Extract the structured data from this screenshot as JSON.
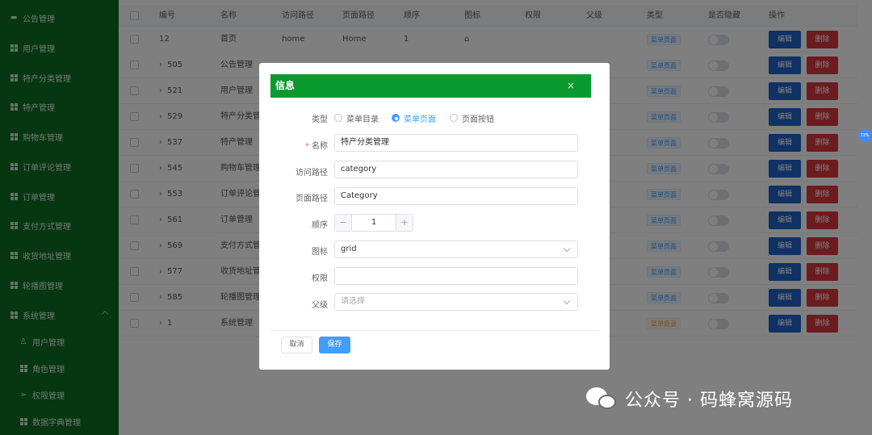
{
  "sidebar": {
    "items": [
      {
        "label": "公告管理",
        "icon": "message-icon"
      },
      {
        "label": "用户管理",
        "icon": "grid-icon"
      },
      {
        "label": "特产分类管理",
        "icon": "grid-icon"
      },
      {
        "label": "特产管理",
        "icon": "grid-icon"
      },
      {
        "label": "购物车管理",
        "icon": "grid-icon"
      },
      {
        "label": "订单评论管理",
        "icon": "grid-icon"
      },
      {
        "label": "订单管理",
        "icon": "grid-icon"
      },
      {
        "label": "支付方式管理",
        "icon": "grid-icon"
      },
      {
        "label": "收货地址管理",
        "icon": "grid-icon"
      },
      {
        "label": "轮播图管理",
        "icon": "grid-icon"
      },
      {
        "label": "系统管理",
        "icon": "apps-icon"
      }
    ],
    "sub_items": [
      {
        "label": "用户管理",
        "icon": "user-icon"
      },
      {
        "label": "角色管理",
        "icon": "grid-icon"
      },
      {
        "label": "权限管理",
        "icon": "send-icon"
      },
      {
        "label": "数据字典管理",
        "icon": "grid-icon"
      }
    ]
  },
  "table": {
    "columns": [
      "编号",
      "名称",
      "访问路径",
      "页面路径",
      "顺序",
      "图标",
      "权限",
      "父级",
      "类型",
      "是否隐藏",
      "操作"
    ],
    "rows": [
      {
        "id": "12",
        "name": "首页",
        "path": "home",
        "page": "Home",
        "order": "1",
        "icon": "⌂",
        "type": "菜单页面",
        "type_color": "blue",
        "expand": false
      },
      {
        "id": "505",
        "name": "公告管理",
        "path": "",
        "page": "",
        "order": "",
        "icon": "▪",
        "type": "菜单页面",
        "type_color": "blue",
        "expand": true
      },
      {
        "id": "521",
        "name": "用户管理",
        "path": "",
        "page": "",
        "order": "",
        "icon": "",
        "type": "菜单页面",
        "type_color": "blue",
        "expand": true
      },
      {
        "id": "529",
        "name": "特产分类管理",
        "path": "",
        "page": "",
        "order": "",
        "icon": "",
        "type": "菜单页面",
        "type_color": "blue",
        "expand": true
      },
      {
        "id": "537",
        "name": "特产管理",
        "path": "",
        "page": "",
        "order": "",
        "icon": "",
        "type": "菜单页面",
        "type_color": "blue",
        "expand": true
      },
      {
        "id": "545",
        "name": "购物车管理",
        "path": "",
        "page": "",
        "order": "",
        "icon": "",
        "type": "菜单页面",
        "type_color": "blue",
        "expand": true
      },
      {
        "id": "553",
        "name": "订单评论管理",
        "path": "",
        "page": "",
        "order": "",
        "icon": "",
        "type": "菜单页面",
        "type_color": "blue",
        "expand": true
      },
      {
        "id": "561",
        "name": "订单管理",
        "path": "",
        "page": "",
        "order": "",
        "icon": "",
        "type": "菜单页面",
        "type_color": "blue",
        "expand": true
      },
      {
        "id": "569",
        "name": "支付方式管理",
        "path": "",
        "page": "",
        "order": "",
        "icon": "",
        "type": "菜单页面",
        "type_color": "blue",
        "expand": true
      },
      {
        "id": "577",
        "name": "收货地址管理",
        "path": "",
        "page": "",
        "order": "",
        "icon": "",
        "type": "菜单页面",
        "type_color": "blue",
        "expand": true
      },
      {
        "id": "585",
        "name": "轮播图管理",
        "path": "",
        "page": "",
        "order": "",
        "icon": "",
        "type": "菜单页面",
        "type_color": "blue",
        "expand": true
      },
      {
        "id": "1",
        "name": "系统管理",
        "path": "",
        "page": "",
        "order": "",
        "icon": "",
        "type": "菜单目录",
        "type_color": "orange",
        "expand": true
      }
    ],
    "edit_label": "编辑",
    "delete_label": "删除"
  },
  "dialog": {
    "title": "信息",
    "close": "×",
    "type_label": "类型",
    "type_options": [
      "菜单目录",
      "菜单页面",
      "页面按钮"
    ],
    "type_selected": 1,
    "name_label": "名称",
    "name_required": "*",
    "name_value": "特产分类管理",
    "path_label": "访问路径",
    "path_value": "category",
    "page_label": "页面路径",
    "page_value": "Category",
    "order_label": "顺序",
    "order_value": "1",
    "order_minus": "−",
    "order_plus": "+",
    "icon_label": "图标",
    "icon_value": "grid",
    "perm_label": "权限",
    "perm_value": "",
    "parent_label": "父级",
    "parent_placeholder": "请选择",
    "cancel_label": "取消",
    "save_label": "保存"
  },
  "float_badge": "73%",
  "watermark": "公众号 · 码蜂窝源码",
  "colors": {
    "sidebar_bg": "#0d6f22",
    "dialog_header": "#0b9a2f",
    "primary": "#409eff",
    "edit_btn": "#1e63c7",
    "delete_btn": "#d9363e"
  }
}
